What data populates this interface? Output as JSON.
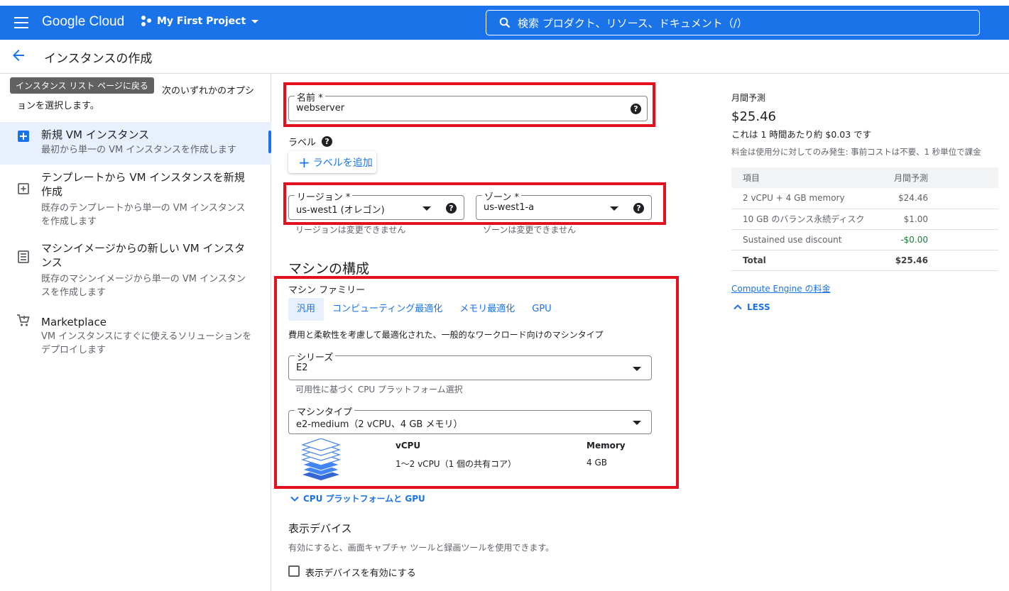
{
  "topbar": {
    "logo": "Google Cloud",
    "project": "My First Project",
    "search_placeholder": "検索  プロダクト、リソース、ドキュメント（/）"
  },
  "header": {
    "title": "インスタンスの作成"
  },
  "left": {
    "tooltip": "インスタンス リスト ページに戻る",
    "intro": "次のいずれかのオプションを選択します。",
    "options": [
      {
        "title": "新規 VM インスタンス",
        "desc": "最初から単一の VM インスタンスを作成します",
        "icon": "add-box-icon"
      },
      {
        "title": "テンプレートから VM インスタンスを新規作成",
        "desc": "既存のテンプレートから単一の VM インスタンスを作成します",
        "icon": "template-icon"
      },
      {
        "title": "マシンイメージからの新しい VM インスタンス",
        "desc": "既存のマシンイメージから単一の VM インスタンスを作成します",
        "icon": "machine-image-icon"
      },
      {
        "title": "Marketplace",
        "desc": "VM インスタンスにすぐに使えるソリューションをデプロイします",
        "icon": "cart-icon"
      }
    ]
  },
  "form": {
    "name_label": "名前 *",
    "name_value": "webserver",
    "labels_title": "ラベル",
    "add_label_button": "ラベルを追加",
    "region_label": "リージョン *",
    "region_value": "us-west1 (オレゴン)",
    "region_hint": "リージョンは変更できません",
    "zone_label": "ゾーン *",
    "zone_value": "us-west1-a",
    "zone_hint": "ゾーンは変更できません",
    "machine_config_title": "マシンの構成",
    "machine_family_title": "マシン ファミリー",
    "family_tabs": [
      "汎用",
      "コンピューティング最適化",
      "メモリ最適化",
      "GPU"
    ],
    "family_desc": "費用と柔軟性を考慮して最適化された、一般的なワークロード向けのマシンタイプ",
    "series_label": "シリーズ",
    "series_value": "E2",
    "series_hint": "可用性に基づく CPU プラットフォーム選択",
    "machine_type_label": "マシンタイプ",
    "machine_type_value": "e2-medium（2 vCPU、4 GB メモリ）",
    "spec_vcpu_header": "vCPU",
    "spec_vcpu_value": "1〜2 vCPU（1 個の共有コア）",
    "spec_memory_header": "Memory",
    "spec_memory_value": "4 GB",
    "cpu_platform_link": "CPU プラットフォームと GPU",
    "display_device_title": "表示デバイス",
    "display_device_desc": "有効にすると、画面キャプチャ ツールと録画ツールを使用できます。",
    "display_device_checkbox": "表示デバイスを有効にする"
  },
  "pricing": {
    "monthly_label": "月間予測",
    "monthly_total": "$25.46",
    "hourly": "これは 1 時間あたり約 $0.03 です",
    "note": "料金は使用分に対してのみ発生: 事前コストは不要、1 秒単位で課金",
    "table_header": {
      "item": "項目",
      "estimate": "月間予測"
    },
    "rows": [
      {
        "item": "2 vCPU + 4 GB memory",
        "cost": "$24.46"
      },
      {
        "item": "10 GB のバランス永続ディスク",
        "cost": "$1.00"
      },
      {
        "item": "Sustained use discount",
        "cost": "-$0.00"
      }
    ],
    "total_label": "Total",
    "total_value": "$25.46",
    "pricing_link": "Compute Engine の料金",
    "less_label": "LESS"
  },
  "colors": {
    "brand_blue": "#1a73e8",
    "highlight_red": "#e3101e",
    "discount_green": "#188038"
  }
}
